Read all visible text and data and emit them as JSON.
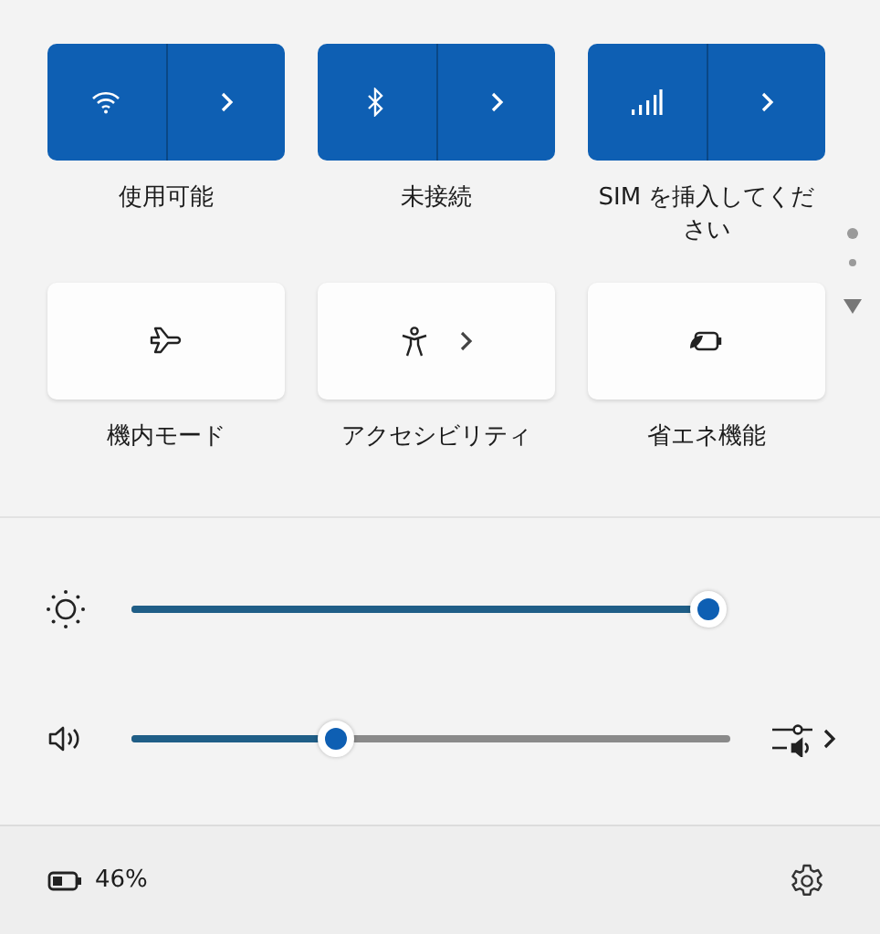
{
  "tiles": [
    {
      "kind": "split",
      "label": "使用可能",
      "on": true
    },
    {
      "kind": "split",
      "label": "未接続",
      "on": true
    },
    {
      "kind": "split",
      "label": "SIM を挿入してください",
      "on": true
    },
    {
      "kind": "single",
      "label": "機内モード",
      "on": false,
      "chevron": false
    },
    {
      "kind": "single",
      "label": "アクセシビリティ",
      "on": false,
      "chevron": true
    },
    {
      "kind": "single",
      "label": "省エネ機能",
      "on": false,
      "chevron": false
    }
  ],
  "sliders": [
    {
      "kind": "brightness",
      "level": 1.0
    },
    {
      "kind": "volume",
      "level": 0.34
    }
  ],
  "battery": {
    "reading": "46%"
  }
}
